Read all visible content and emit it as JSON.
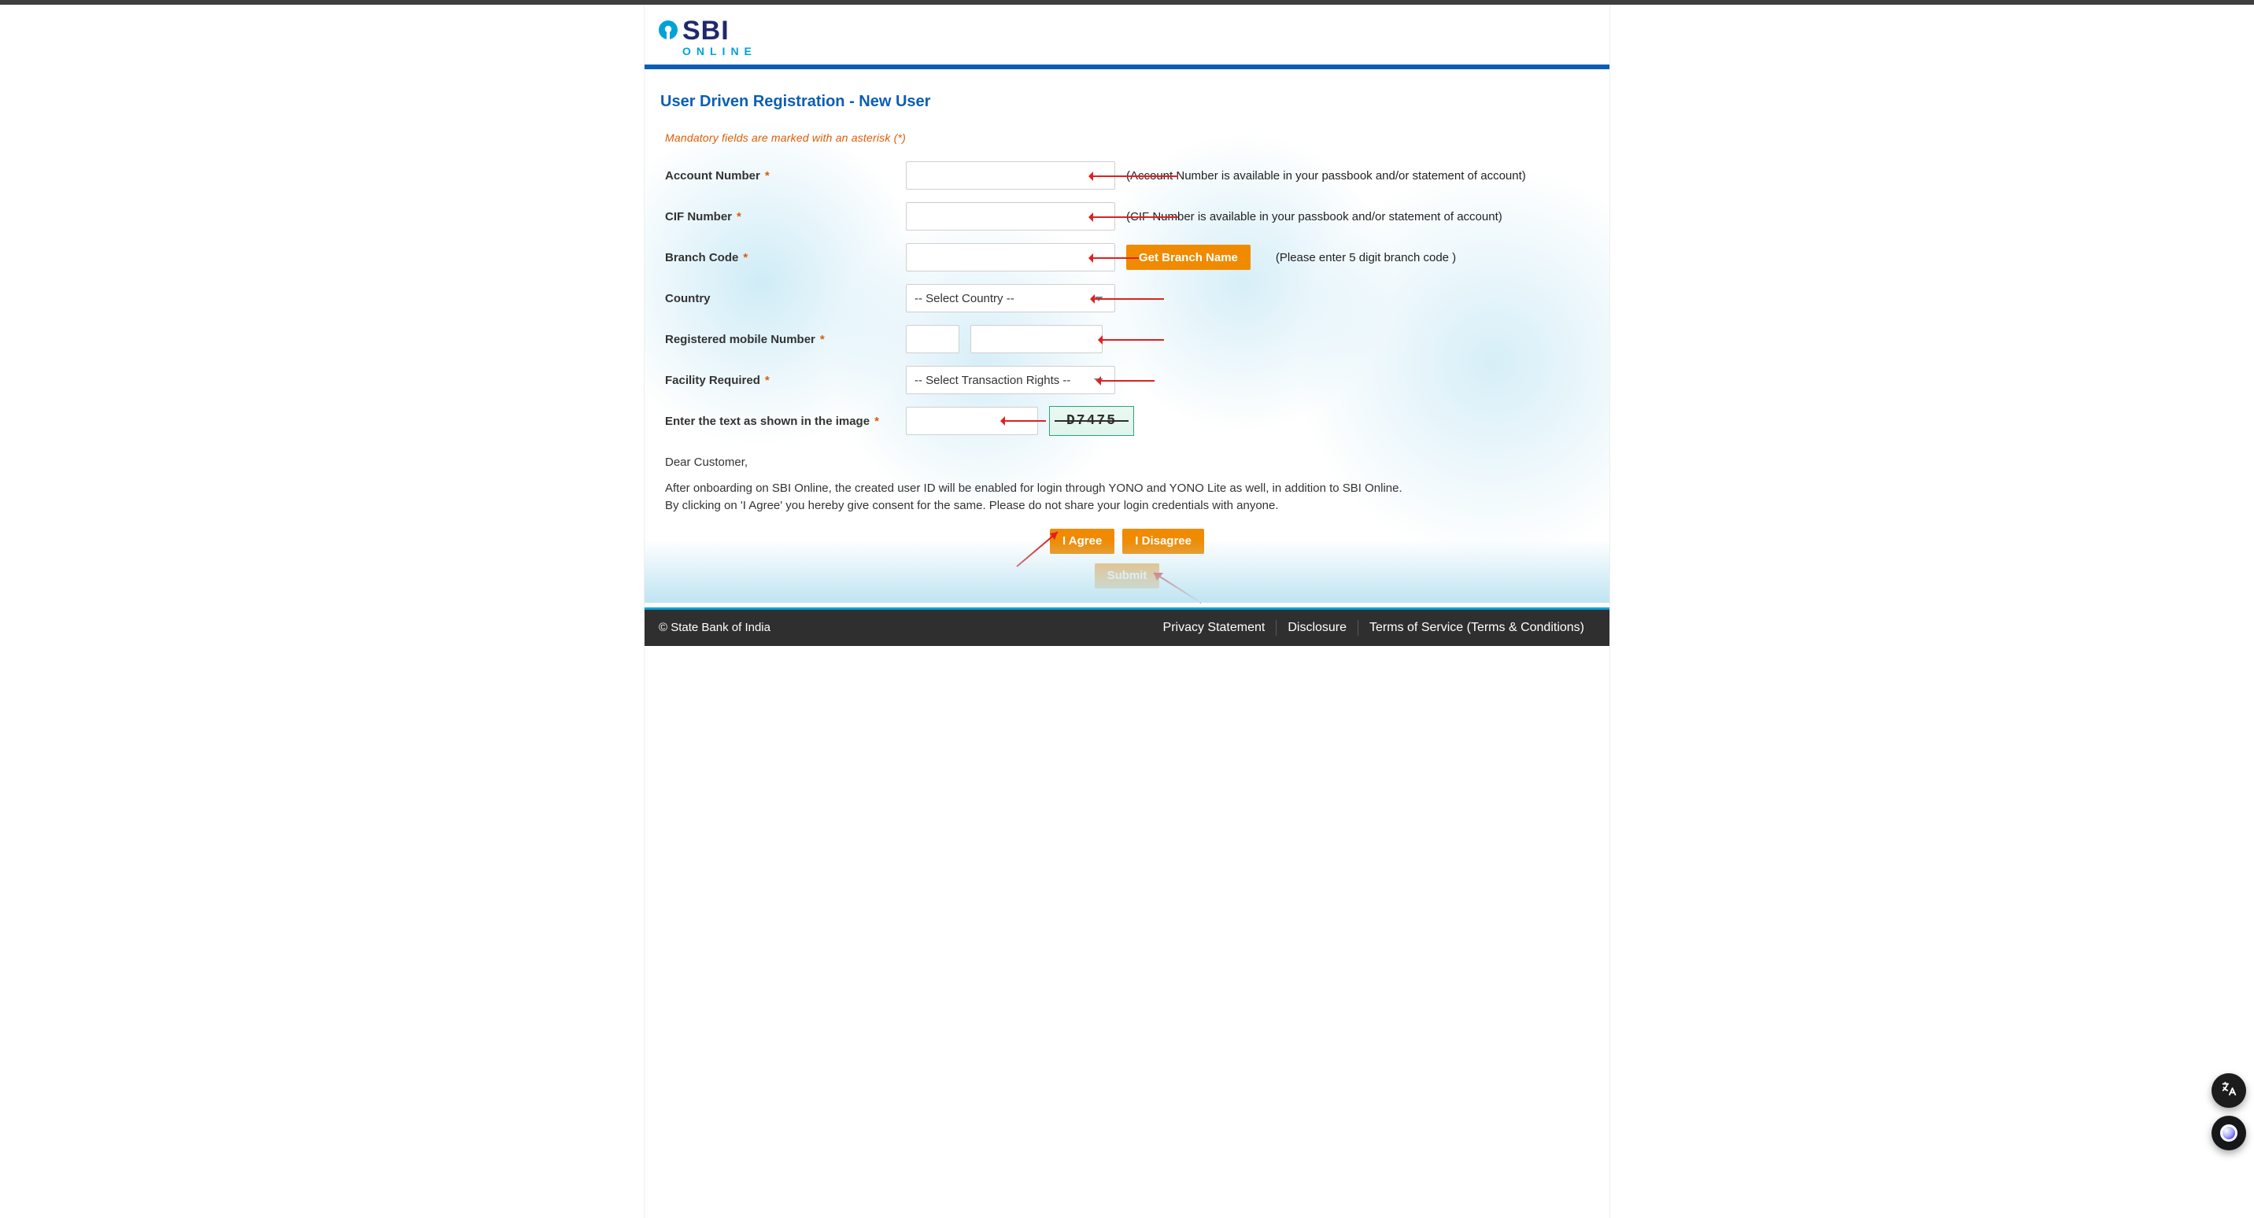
{
  "brand": {
    "sbi": "SBI",
    "online": "ONLINE"
  },
  "page": {
    "title": "User Driven Registration - New User",
    "mandatory_note": "Mandatory fields are marked with an asterisk (*)"
  },
  "labels": {
    "account_number": "Account Number",
    "cif_number": "CIF Number",
    "branch_code": "Branch Code",
    "country": "Country",
    "mobile": "Registered mobile Number",
    "facility": "Facility Required",
    "captcha": "Enter the text as shown in the image"
  },
  "hints": {
    "account_number": "(Account Number is available in your passbook and/or statement of account)",
    "cif_number": "(CIF Number is available in your passbook and/or statement of account)",
    "branch_code": "(Please enter 5 digit branch code )"
  },
  "buttons": {
    "get_branch": "Get Branch Name",
    "agree": "I Agree",
    "disagree": "I Disagree",
    "submit": "Submit"
  },
  "selects": {
    "country_placeholder": "-- Select Country --",
    "facility_placeholder": "-- Select Transaction Rights --"
  },
  "values": {
    "account_number": "",
    "cif_number": "",
    "branch_code": "",
    "country": "",
    "mobile_cc": "",
    "mobile": "",
    "facility": "",
    "captcha_input": ""
  },
  "captcha": {
    "text": "D7475"
  },
  "consent": {
    "dear": "Dear Customer,",
    "line1": "After onboarding on SBI Online, the created user ID will be enabled for login through YONO and YONO Lite as well, in addition to SBI Online.",
    "line2": "By clicking on 'I Agree' you hereby give consent for the same. Please do not share your login credentials with anyone."
  },
  "footer": {
    "copyright": "© State Bank of India",
    "links": {
      "privacy": "Privacy Statement",
      "disclosure": "Disclosure",
      "terms": "Terms of Service (Terms & Conditions)"
    }
  },
  "colors": {
    "primary": "#0b5eb5",
    "accent": "#f08a00",
    "info": "#00a2d8",
    "danger": "#e02020"
  }
}
